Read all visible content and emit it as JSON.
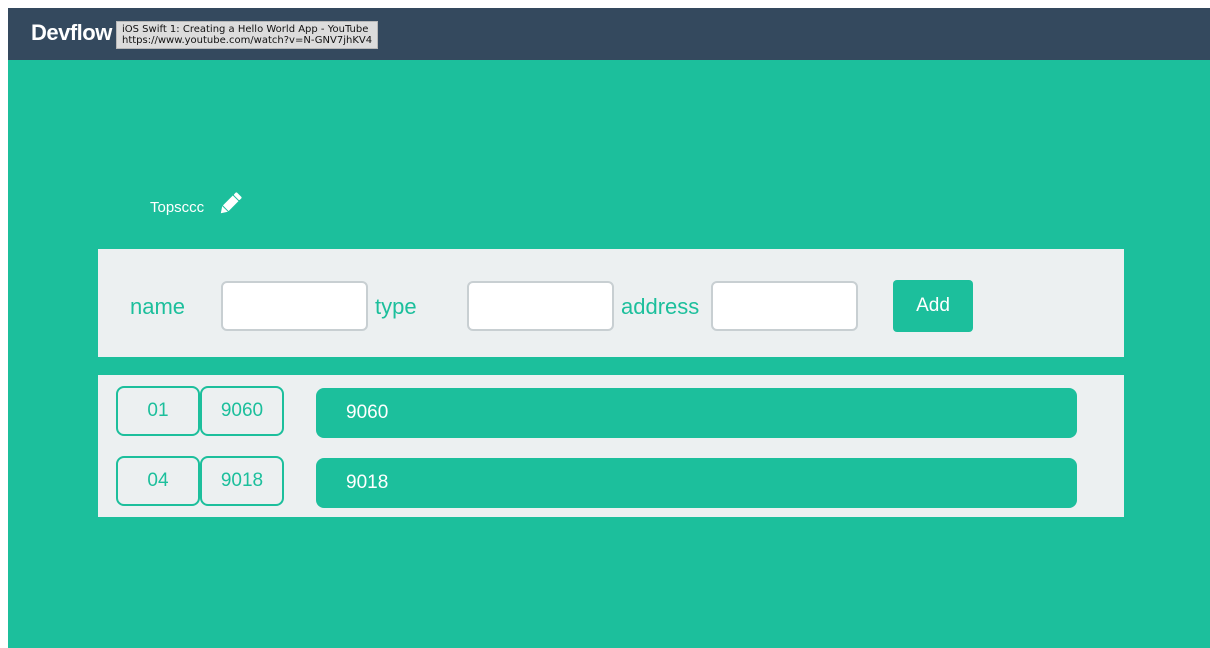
{
  "navbar": {
    "brand": "Devflow",
    "tooltip": {
      "title": "iOS Swift 1: Creating a Hello World App - YouTube",
      "url": "https://www.youtube.com/watch?v=N-GNV7jhKV4"
    }
  },
  "page": {
    "title": "Topsccc",
    "edit_icon": "pencil-icon"
  },
  "form": {
    "name_label": "name",
    "name_value": "",
    "type_label": "type",
    "type_value": "",
    "address_label": "address",
    "address_value": "",
    "add_label": "Add"
  },
  "items": [
    {
      "id": "01",
      "type": "9060",
      "address": "9060"
    },
    {
      "id": "04",
      "type": "9018",
      "address": "9018"
    }
  ],
  "colors": {
    "accent": "#1cbf9c",
    "navbar": "#34495e",
    "panel": "#ecf0f1"
  }
}
